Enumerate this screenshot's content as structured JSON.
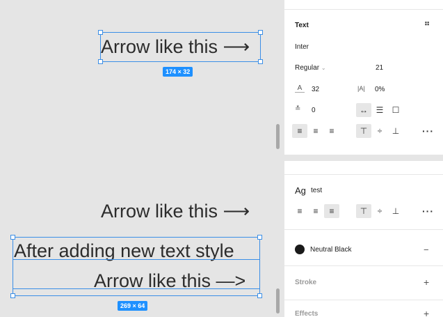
{
  "canvas": {
    "top_text": "Arrow like this ⟶",
    "top_dimensions": "174 × 32",
    "middle_text": "Arrow like this ⟶",
    "bottom_line1": "After adding new text style",
    "bottom_line2": "Arrow like this —>",
    "bottom_dimensions": "269 × 64"
  },
  "text_panel": {
    "title": "Text",
    "font_family": "Inter",
    "font_weight": "Regular",
    "font_size": "21",
    "line_height": "32",
    "letter_spacing": "0%",
    "paragraph_spacing": "0"
  },
  "style_panel": {
    "style_preview": "Ag",
    "style_name": "test",
    "fill_name": "Neutral Black",
    "stroke_label": "Stroke",
    "effects_label": "Effects"
  },
  "colors": {
    "selection": "#3a8ee6",
    "badge": "#1e90ff",
    "canvas_bg": "#e5e5e5"
  }
}
